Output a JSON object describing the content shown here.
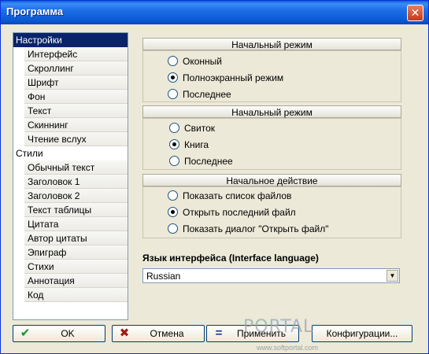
{
  "window": {
    "title": "Программа",
    "close_glyph": "✕"
  },
  "tree": {
    "items": [
      {
        "label": "Настройки",
        "level": 0,
        "selected": true
      },
      {
        "label": "Интерфейс",
        "level": 1
      },
      {
        "label": "Скроллинг",
        "level": 1
      },
      {
        "label": "Шрифт",
        "level": 1
      },
      {
        "label": "Фон",
        "level": 1
      },
      {
        "label": "Текст",
        "level": 1
      },
      {
        "label": "Скиннинг",
        "level": 1
      },
      {
        "label": "Чтение вслух",
        "level": 1
      },
      {
        "label": "Стили",
        "level": 0
      },
      {
        "label": "Обычный текст",
        "level": 1
      },
      {
        "label": "Заголовок 1",
        "level": 1
      },
      {
        "label": "Заголовок 2",
        "level": 1
      },
      {
        "label": "Текст таблицы",
        "level": 1
      },
      {
        "label": "Цитата",
        "level": 1
      },
      {
        "label": "Автор цитаты",
        "level": 1
      },
      {
        "label": "Эпиграф",
        "level": 1
      },
      {
        "label": "Стихи",
        "level": 1
      },
      {
        "label": "Аннотация",
        "level": 1
      },
      {
        "label": "Код",
        "level": 1
      }
    ]
  },
  "groups": [
    {
      "title": "Начальный режим",
      "options": [
        {
          "label": "Оконный",
          "checked": false
        },
        {
          "label": "Полноэкранный режим",
          "checked": true
        },
        {
          "label": "Последнее",
          "checked": false
        }
      ]
    },
    {
      "title": "Начальный режим",
      "options": [
        {
          "label": "Свиток",
          "checked": false
        },
        {
          "label": "Книга",
          "checked": true
        },
        {
          "label": "Последнее",
          "checked": false
        }
      ]
    },
    {
      "title": "Начальное действие",
      "options": [
        {
          "label": "Показать список файлов",
          "checked": false
        },
        {
          "label": "Открыть последний файл",
          "checked": true
        },
        {
          "label": "Показать диалог \"Открыть файл\"",
          "checked": false
        }
      ]
    }
  ],
  "language": {
    "label": "Язык интерфейса (Interface language)",
    "selected": "Russian"
  },
  "buttons": {
    "ok": {
      "label": "OK",
      "icon": "check-icon",
      "color": "#1e8c2a"
    },
    "cancel": {
      "label": "Отмена",
      "icon": "cross-icon",
      "color": "#9c1c12"
    },
    "apply": {
      "label": "Применить",
      "icon": "equals-icon",
      "color": "#1d3a8a"
    },
    "config": {
      "label": "Конфигурации..."
    }
  },
  "watermark": {
    "text": "PORTAL",
    "url": "www.softportal.com"
  }
}
